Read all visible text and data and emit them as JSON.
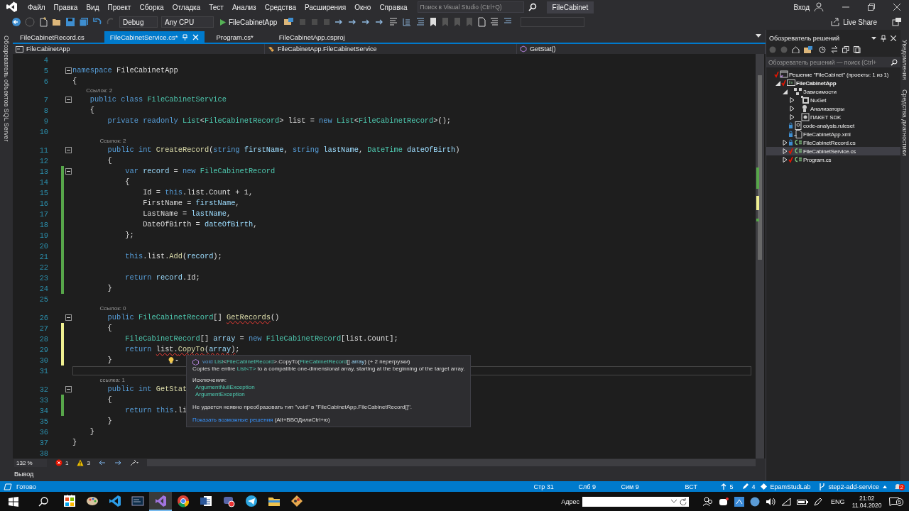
{
  "menu_bar": {
    "items": [
      "Файл",
      "Правка",
      "Вид",
      "Проект",
      "Сборка",
      "Отладка",
      "Тест",
      "Анализ",
      "Средства",
      "Расширения",
      "Окно",
      "Справка"
    ],
    "search": {
      "placeholder": "Поиск в Visual Studio (Ctrl+Q)"
    },
    "title": "FileCabinet",
    "sign_in": "Вход"
  },
  "toolbar": {
    "configuration": "Debug",
    "platform": "Any CPU",
    "start": "FileCabinetApp",
    "live_share": "Live Share"
  },
  "left_tabs": [
    "Обозреватель объектов SQL Server"
  ],
  "editor_tabs": [
    {
      "label": "FileCabinetRecord.cs",
      "selected": false
    },
    {
      "label": "FileCabinetService.cs*",
      "selected": true
    },
    {
      "label": "Program.cs*",
      "selected": false
    },
    {
      "label": "FileCabinetApp.csproj",
      "selected": false
    }
  ],
  "nav_bar": {
    "project": "FileCabinetApp",
    "type": "FileCabinetApp.FileCabinetService",
    "member": "GetStat()"
  },
  "code": [
    {
      "kind": "line",
      "number": "4"
    },
    {
      "kind": "line",
      "number": "5",
      "fold": true,
      "tokens": [
        {
          "text": "namespace",
          "kind": "keyword"
        },
        " FileCabinetApp"
      ]
    },
    {
      "kind": "line",
      "number": "6",
      "tokens": [
        "{"
      ]
    },
    {
      "kind": "lens",
      "text": "Ссылок: 2"
    },
    {
      "kind": "line",
      "number": "7",
      "fold": true,
      "tokens": [
        {
          "text": "    public class ",
          "kind": "keyword"
        },
        {
          "text": "FileCabinetService",
          "kind": "type"
        }
      ]
    },
    {
      "kind": "line",
      "number": "8",
      "tokens": [
        "    {"
      ]
    },
    {
      "kind": "line",
      "number": "9",
      "tokens": [
        {
          "text": "        private readonly ",
          "kind": "keyword"
        },
        {
          "text": "List",
          "kind": "type"
        },
        "<",
        {
          "text": "FileCabinetRecord",
          "kind": "type"
        },
        "> list = ",
        {
          "text": "new ",
          "kind": "keyword"
        },
        {
          "text": "List",
          "kind": "type"
        },
        "<",
        {
          "text": "FileCabinetRecord",
          "kind": "type"
        },
        ">();"
      ]
    },
    {
      "kind": "line",
      "number": "10"
    },
    {
      "kind": "lens",
      "text": "Ссылок: 2"
    },
    {
      "kind": "line",
      "number": "11",
      "fold": true,
      "tokens": [
        {
          "text": "        public int ",
          "kind": "keyword"
        },
        {
          "text": "CreateRecord",
          "kind": "method"
        },
        "(",
        {
          "text": "string ",
          "kind": "keyword"
        },
        {
          "text": "firstName",
          "kind": "variable"
        },
        ", ",
        {
          "text": "string ",
          "kind": "keyword"
        },
        {
          "text": "lastName",
          "kind": "variable"
        },
        ", ",
        {
          "text": "DateTime ",
          "kind": "type"
        },
        {
          "text": "dateOfBirth",
          "kind": "variable"
        },
        ")"
      ]
    },
    {
      "kind": "line",
      "number": "12",
      "tokens": [
        "        {"
      ]
    },
    {
      "kind": "line",
      "number": "13",
      "changed": true,
      "saved": true,
      "fold": true,
      "tokens": [
        {
          "text": "            var ",
          "kind": "keyword"
        },
        {
          "text": "record",
          "kind": "variable"
        },
        " = ",
        {
          "text": "new ",
          "kind": "keyword"
        },
        {
          "text": "FileCabinetRecord",
          "kind": "type"
        }
      ]
    },
    {
      "kind": "line",
      "number": "14",
      "changed": true,
      "saved": true,
      "tokens": [
        "            {"
      ]
    },
    {
      "kind": "line",
      "number": "15",
      "changed": true,
      "saved": true,
      "tokens": [
        "                Id = ",
        {
          "text": "this",
          "kind": "keyword"
        },
        ".list.Count + 1,"
      ]
    },
    {
      "kind": "line",
      "number": "16",
      "changed": true,
      "saved": true,
      "tokens": [
        "                FirstName = ",
        {
          "text": "firstName",
          "kind": "variable"
        },
        ","
      ]
    },
    {
      "kind": "line",
      "number": "17",
      "changed": true,
      "saved": true,
      "tokens": [
        "                LastName = ",
        {
          "text": "lastName",
          "kind": "variable"
        },
        ","
      ]
    },
    {
      "kind": "line",
      "number": "18",
      "changed": true,
      "saved": true,
      "tokens": [
        "                DateOfBirth = ",
        {
          "text": "dateOfBirth",
          "kind": "variable"
        },
        ","
      ]
    },
    {
      "kind": "line",
      "number": "19",
      "changed": true,
      "saved": true,
      "tokens": [
        "            };"
      ]
    },
    {
      "kind": "line",
      "number": "20",
      "changed": true,
      "saved": true
    },
    {
      "kind": "line",
      "number": "21",
      "changed": true,
      "saved": true,
      "tokens": [
        {
          "text": "            this",
          "kind": "keyword"
        },
        ".list.",
        {
          "text": "Add",
          "kind": "method"
        },
        "(",
        {
          "text": "record",
          "kind": "variable"
        },
        ");"
      ]
    },
    {
      "kind": "line",
      "number": "22",
      "changed": true,
      "saved": true
    },
    {
      "kind": "line",
      "number": "23",
      "changed": true,
      "saved": true,
      "tokens": [
        {
          "text": "            return ",
          "kind": "keyword"
        },
        {
          "text": "record",
          "kind": "variable"
        },
        ".Id;"
      ]
    },
    {
      "kind": "line",
      "number": "24",
      "changed": true,
      "saved": true,
      "tokens": [
        "        }"
      ]
    },
    {
      "kind": "line",
      "number": "25"
    },
    {
      "kind": "lens",
      "text": "Ссылок: 0"
    },
    {
      "kind": "line",
      "number": "26",
      "fold": true,
      "tokens": [
        {
          "text": "        public ",
          "kind": "keyword"
        },
        {
          "text": "FileCabinetRecord",
          "kind": "type"
        },
        "[] ",
        {
          "text": "GetRecords",
          "kind": "method",
          "squiggle": true
        },
        "()"
      ]
    },
    {
      "kind": "line",
      "number": "27",
      "changed": true,
      "saved": false,
      "tokens": [
        "        {"
      ]
    },
    {
      "kind": "line",
      "number": "28",
      "changed": true,
      "saved": false,
      "tokens": [
        {
          "text": "            FileCabinetRecord",
          "kind": "type"
        },
        "[] ",
        {
          "text": "array",
          "kind": "variable"
        },
        " = ",
        {
          "text": "new ",
          "kind": "keyword"
        },
        {
          "text": "FileCabinetRecord",
          "kind": "type"
        },
        "[list.Count];"
      ]
    },
    {
      "kind": "line",
      "number": "29",
      "changed": true,
      "saved": false,
      "tokens": [
        {
          "text": "            return ",
          "kind": "keyword"
        },
        {
          "text": "list.",
          "kind": "plain",
          "squiggle": true
        },
        {
          "text": "CopyTo",
          "kind": "method",
          "squiggle": true
        },
        {
          "text": "(",
          "kind": "plain",
          "squiggle": true
        },
        {
          "text": "array",
          "kind": "variable",
          "squiggle": true
        },
        {
          "text": ")",
          "kind": "plain",
          "squiggle": true
        },
        ";"
      ]
    },
    {
      "kind": "line",
      "number": "30",
      "changed": true,
      "saved": false,
      "bulb": true,
      "tokens": [
        "        }"
      ]
    },
    {
      "kind": "line",
      "number": "31",
      "current": true
    },
    {
      "kind": "lens",
      "text": "ссылка: 1"
    },
    {
      "kind": "line",
      "number": "32",
      "fold": true,
      "tokens": [
        {
          "text": "        public int ",
          "kind": "keyword"
        },
        {
          "text": "GetStat",
          "kind": "method"
        }
      ]
    },
    {
      "kind": "line",
      "number": "33",
      "changed": true,
      "saved": true,
      "tokens": [
        "        {"
      ]
    },
    {
      "kind": "line",
      "number": "34",
      "changed": true,
      "saved": true,
      "tokens": [
        {
          "text": "            return this",
          "kind": "keyword"
        },
        ".li"
      ]
    },
    {
      "kind": "line",
      "number": "35",
      "tokens": [
        "        }"
      ]
    },
    {
      "kind": "line",
      "number": "36",
      "tokens": [
        "    }"
      ]
    },
    {
      "kind": "line",
      "number": "37",
      "tokens": [
        "}"
      ]
    },
    {
      "kind": "line",
      "number": "38"
    }
  ],
  "quick_info": {
    "signature": [
      {
        "text": "void ",
        "kind": "keyword"
      },
      {
        "text": "List",
        "kind": "type"
      },
      "<",
      {
        "text": "FileCabinetRecord",
        "kind": "type"
      },
      ">.CopyTo(",
      {
        "text": "FileCabinetRecord",
        "kind": "type"
      },
      "[] ",
      {
        "text": "array",
        "kind": "variable"
      },
      ") (+ 2 перегрузки)"
    ],
    "description": [
      "Copies the entire ",
      {
        "text": "List<T>",
        "kind": "type"
      },
      " to a compatible one-dimensional array, starting at the beginning of the target array."
    ],
    "exceptions_label": "Исключения:",
    "exceptions": [
      "ArgumentNullException",
      "ArgumentException"
    ],
    "error": "Не удается неявно преобразовать тип \"void\" в \"FileCabinetApp.FileCabinetRecord[]\".",
    "fix_link": "Показать возможные решения",
    "fix_shortcut": "(Alt+ВВОДилиCtrl+ю)"
  },
  "editor_footer": {
    "zoom": "132 %",
    "errors": "1",
    "warnings": "3"
  },
  "output_tab": "Вывод",
  "solution_explorer": {
    "title": "Обозреватель решений",
    "search": {
      "placeholder": "Обозреватель решений — поиск (Ctrl+"
    },
    "tree": [
      {
        "label": "Решение \"FileCabinet\" (проекты: 1 из 1)",
        "kind": "solution",
        "checked_in": false,
        "selected": false,
        "children": [
          {
            "label": "FileCabinetApp",
            "kind": "project",
            "checked_in": false,
            "expanded": true,
            "selected": false,
            "children": [
              {
                "label": "Зависимости",
                "kind": "deps",
                "expanded": true,
                "selected": false,
                "children": [
                  {
                    "label": "NuGet",
                    "kind": "nuget",
                    "expanded": false,
                    "selected": false
                  },
                  {
                    "label": "Анализаторы",
                    "kind": "analyzers",
                    "expanded": false,
                    "selected": false
                  },
                  {
                    "label": "ПАКЕТ SDK",
                    "kind": "sdk",
                    "expanded": false,
                    "selected": false
                  }
                ]
              },
              {
                "label": "code-analysis.ruleset",
                "kind": "ruleset",
                "checked_in": true,
                "selected": false
              },
              {
                "label": "FileCabinetApp.xml",
                "kind": "xml",
                "checked_in": true,
                "selected": false
              },
              {
                "label": "FileCabinetRecord.cs",
                "kind": "cs",
                "checked_in": true,
                "expanded": false,
                "selected": false
              },
              {
                "label": "FileCabinetService.cs",
                "kind": "cs",
                "checked_in": false,
                "expanded": false,
                "selected": true
              },
              {
                "label": "Program.cs",
                "kind": "cs",
                "checked_in": false,
                "expanded": false,
                "selected": false
              }
            ]
          }
        ]
      }
    ]
  },
  "right_tabs": [
    "Уведомления",
    "Средства диагностики"
  ],
  "status_bar": {
    "message": "Готово",
    "line": "Стр 31",
    "column": "Слб 9",
    "char": "Сим 9",
    "mode": "ВСТ",
    "pushes": "5",
    "changes": "4",
    "repo": "EpamStudLab",
    "branch": "step2-add-service",
    "notifications": "2"
  },
  "taskbar": {
    "apps": [
      {
        "kind": "store",
        "selected": false
      },
      {
        "kind": "paint",
        "selected": false
      },
      {
        "kind": "vscode",
        "selected": false
      },
      {
        "kind": "terminal",
        "selected": false
      },
      {
        "kind": "vs",
        "selected": true
      },
      {
        "kind": "chrome",
        "selected": false
      },
      {
        "kind": "word",
        "selected": false
      },
      {
        "kind": "recorder",
        "selected": false
      },
      {
        "kind": "telegram",
        "selected": false
      },
      {
        "kind": "folder",
        "selected": false
      },
      {
        "kind": "git",
        "selected": false
      }
    ],
    "address_label": "Адрес",
    "language": "ENG",
    "time": "21:02",
    "date": "11.04.2020",
    "notifications": "5"
  }
}
